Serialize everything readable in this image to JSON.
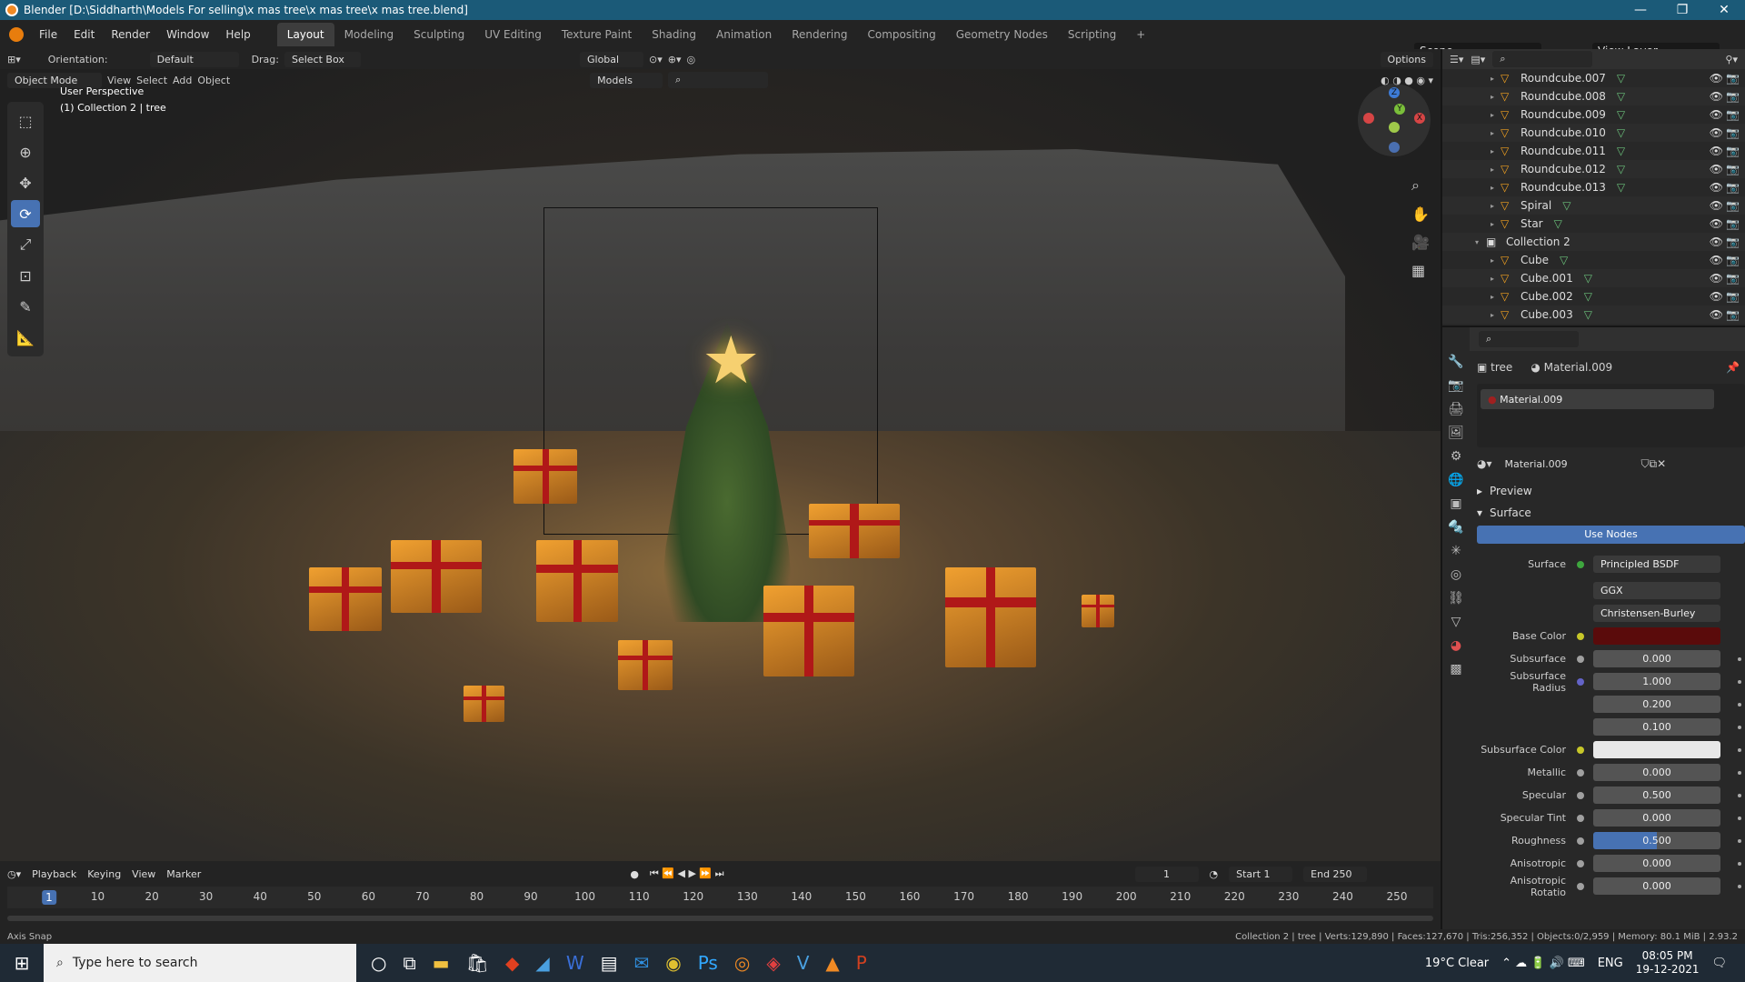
{
  "window": {
    "title": "Blender [D:\\Siddharth\\Models For selling\\x mas tree\\x mas tree\\x mas tree.blend]",
    "min": "—",
    "max": "❐",
    "close": "✕"
  },
  "menu": [
    "File",
    "Edit",
    "Render",
    "Window",
    "Help"
  ],
  "workspaces": [
    "Layout",
    "Modeling",
    "Sculpting",
    "UV Editing",
    "Texture Paint",
    "Shading",
    "Animation",
    "Rendering",
    "Compositing",
    "Geometry Nodes",
    "Scripting",
    "+"
  ],
  "scene": {
    "label": "Scene",
    "view_layer": "View Layer"
  },
  "viewport": {
    "orientation_label": "Orientation:",
    "orientation_value": "Default",
    "drag_label": "Drag:",
    "drag_value": "Select Box",
    "transform": "Global",
    "options": "Options",
    "mode": "Object Mode",
    "view": "View",
    "select": "Select",
    "add": "Add",
    "object": "Object",
    "models": "Models",
    "hud_line1": "User Perspective",
    "hud_line2": "(1) Collection 2 | tree",
    "gizmo": {
      "x": "X",
      "y": "Y",
      "z": "Z"
    }
  },
  "timeline": {
    "playback": "Playback",
    "keying": "Keying",
    "view": "View",
    "marker": "Marker",
    "current_frame": "1",
    "start_label": "Start",
    "start": "1",
    "end_label": "End",
    "end": "250",
    "ticks": [
      "1",
      "10",
      "20",
      "30",
      "40",
      "50",
      "60",
      "70",
      "80",
      "90",
      "100",
      "110",
      "120",
      "130",
      "140",
      "150",
      "160",
      "170",
      "180",
      "190",
      "200",
      "210",
      "220",
      "230",
      "240",
      "250"
    ]
  },
  "status": {
    "left": "Axis Snap",
    "right": "Collection 2 | tree | Verts:129,890 | Faces:127,670 | Tris:256,352 | Objects:0/2,959 | Memory: 80.1 MiB | 2.93.2"
  },
  "outliner": {
    "rows": [
      {
        "name": "Roundcube.007",
        "type": "obj"
      },
      {
        "name": "Roundcube.008",
        "type": "obj"
      },
      {
        "name": "Roundcube.009",
        "type": "obj"
      },
      {
        "name": "Roundcube.010",
        "type": "obj"
      },
      {
        "name": "Roundcube.011",
        "type": "obj"
      },
      {
        "name": "Roundcube.012",
        "type": "obj"
      },
      {
        "name": "Roundcube.013",
        "type": "obj"
      },
      {
        "name": "Spiral",
        "type": "obj"
      },
      {
        "name": "Star",
        "type": "obj"
      },
      {
        "name": "Collection 2",
        "type": "coll"
      },
      {
        "name": "Cube",
        "type": "obj"
      },
      {
        "name": "Cube.001",
        "type": "obj"
      },
      {
        "name": "Cube.002",
        "type": "obj"
      },
      {
        "name": "Cube.003",
        "type": "obj"
      }
    ]
  },
  "properties": {
    "breadcrumb_object": "tree",
    "breadcrumb_material": "Material.009",
    "slot": "Material.009",
    "material": "Material.009",
    "preview": "Preview",
    "surface_section": "Surface",
    "use_nodes": "Use Nodes",
    "surface_label": "Surface",
    "surface_value": "Principled BSDF",
    "distribution": "GGX",
    "subsurface_method": "Christensen-Burley",
    "base_color_label": "Base Color",
    "base_color": "#5a0b0b",
    "subsurface_color": "#e8e8e8",
    "fields": [
      {
        "label": "Subsurface",
        "value": "0.000"
      },
      {
        "label": "Subsurface Radius",
        "value": "1.000"
      },
      {
        "label": "",
        "value": "0.200"
      },
      {
        "label": "",
        "value": "0.100"
      },
      {
        "label": "Subsurface Color",
        "value": ""
      },
      {
        "label": "Metallic",
        "value": "0.000"
      },
      {
        "label": "Specular",
        "value": "0.500"
      },
      {
        "label": "Specular Tint",
        "value": "0.000"
      },
      {
        "label": "Roughness",
        "value": "0.500"
      },
      {
        "label": "Anisotropic",
        "value": "0.000"
      },
      {
        "label": "Anisotropic Rotatio",
        "value": "0.000"
      }
    ],
    "roughness_fraction": 0.5
  },
  "taskbar": {
    "search_placeholder": "Type here to search",
    "weather": "19°C  Clear",
    "lang": "ENG",
    "time": "08:05 PM",
    "date": "19-12-2021"
  }
}
